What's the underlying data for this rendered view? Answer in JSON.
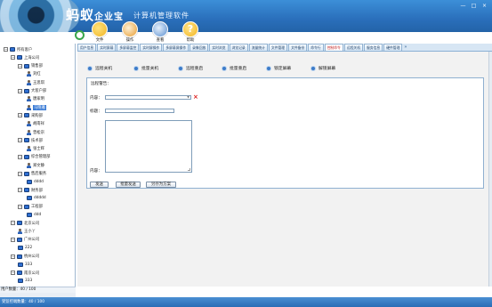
{
  "app": {
    "title_main": "蚂蚁",
    "title_suffix": "企业宝",
    "subtitle": "计算机管理软件",
    "window_buttons": [
      "—",
      "□",
      "×"
    ]
  },
  "toolbar": {
    "items": [
      {
        "label": "文件",
        "icon": "folder-icon",
        "color": "#f0b323"
      },
      {
        "label": "操作",
        "icon": "tools-icon",
        "color": "#e59a2e"
      },
      {
        "label": "查看",
        "icon": "search-icon",
        "color": "#5a8fd0"
      },
      {
        "label": "帮助",
        "icon": "help-icon",
        "color": "#f2b41c"
      }
    ]
  },
  "tabs": [
    {
      "label": "用户信息",
      "active": false
    },
    {
      "label": "实时屏幕",
      "active": false
    },
    {
      "label": "多屏幕监控",
      "active": false
    },
    {
      "label": "实时屏操作",
      "active": false
    },
    {
      "label": "多屏幕屏操作",
      "active": false
    },
    {
      "label": "录像回放",
      "active": false
    },
    {
      "label": "实时浏览",
      "active": false
    },
    {
      "label": "浏览记录",
      "active": false
    },
    {
      "label": "流量统计",
      "active": false
    },
    {
      "label": "文件管理",
      "active": false
    },
    {
      "label": "文件备份",
      "active": false
    },
    {
      "label": "命令行",
      "active": false
    },
    {
      "label": "控制命令",
      "active": true
    },
    {
      "label": "远程关机",
      "active": false
    },
    {
      "label": "服务信息",
      "active": false
    },
    {
      "label": "硬件管理",
      "active": false
    }
  ],
  "tree": {
    "nodes": [
      {
        "label": "所有客户",
        "level": 0,
        "type": "pc",
        "expander": "−"
      },
      {
        "label": "上海公司",
        "level": 1,
        "type": "pc",
        "expander": "−"
      },
      {
        "label": "销售部",
        "level": 2,
        "type": "pc",
        "expander": "−"
      },
      {
        "label": "刘红",
        "level": 3,
        "type": "person"
      },
      {
        "label": "王思琪",
        "level": 3,
        "type": "person"
      },
      {
        "label": "大客户部",
        "level": 2,
        "type": "pc",
        "expander": "−"
      },
      {
        "label": "唐家明",
        "level": 3,
        "type": "person"
      },
      {
        "label": "马晓雅",
        "level": 3,
        "type": "person",
        "selected": true
      },
      {
        "label": "采购部",
        "level": 2,
        "type": "pc",
        "expander": "−"
      },
      {
        "label": "胡南祥",
        "level": 3,
        "type": "person"
      },
      {
        "label": "曾松宗",
        "level": 3,
        "type": "person"
      },
      {
        "label": "技术部",
        "level": 2,
        "type": "pc",
        "expander": "−"
      },
      {
        "label": "张士辉",
        "level": 3,
        "type": "person"
      },
      {
        "label": "综合管理部",
        "level": 2,
        "type": "pc",
        "expander": "−"
      },
      {
        "label": "郑文静",
        "level": 3,
        "type": "person"
      },
      {
        "label": "售后服务",
        "level": 2,
        "type": "pc",
        "expander": "−"
      },
      {
        "label": "dddd",
        "level": 3,
        "type": "pc"
      },
      {
        "label": "财务部",
        "level": 2,
        "type": "pc",
        "expander": "−"
      },
      {
        "label": "ddddd",
        "level": 3,
        "type": "pc"
      },
      {
        "label": "工程部",
        "level": 2,
        "type": "pc",
        "expander": "−"
      },
      {
        "label": "ddd",
        "level": 3,
        "type": "pc"
      },
      {
        "label": "北京公司",
        "level": 1,
        "type": "pc",
        "expander": "−"
      },
      {
        "label": "王小丫",
        "level": 2,
        "type": "person"
      },
      {
        "label": "广州公司",
        "level": 1,
        "type": "pc",
        "expander": "−"
      },
      {
        "label": "222",
        "level": 2,
        "type": "pc"
      },
      {
        "label": "杭州公司",
        "level": 1,
        "type": "pc",
        "expander": "−"
      },
      {
        "label": "333",
        "level": 2,
        "type": "pc"
      },
      {
        "label": "南京公司",
        "level": 1,
        "type": "pc",
        "expander": "−"
      },
      {
        "label": "333",
        "level": 2,
        "type": "pc"
      }
    ],
    "status": "用户数量：40 / 100"
  },
  "actions": [
    {
      "label": "远程关机"
    },
    {
      "label": "批量关机"
    },
    {
      "label": "远程重启"
    },
    {
      "label": "批量重启"
    },
    {
      "label": "锁定屏幕"
    },
    {
      "label": "解锁屏幕"
    }
  ],
  "form": {
    "section_title": "远程警告：",
    "content_label": "内容：",
    "title_label": "标题：",
    "body_label": "内容：",
    "content_value": "",
    "title_value": "",
    "body_value": "",
    "clear_icon": "×"
  },
  "buttons": {
    "send": "发送",
    "batch_send": "批量发送",
    "save_template": "另存为方案"
  },
  "statusbar": {
    "text": "受监控端数量：40 / 100"
  }
}
